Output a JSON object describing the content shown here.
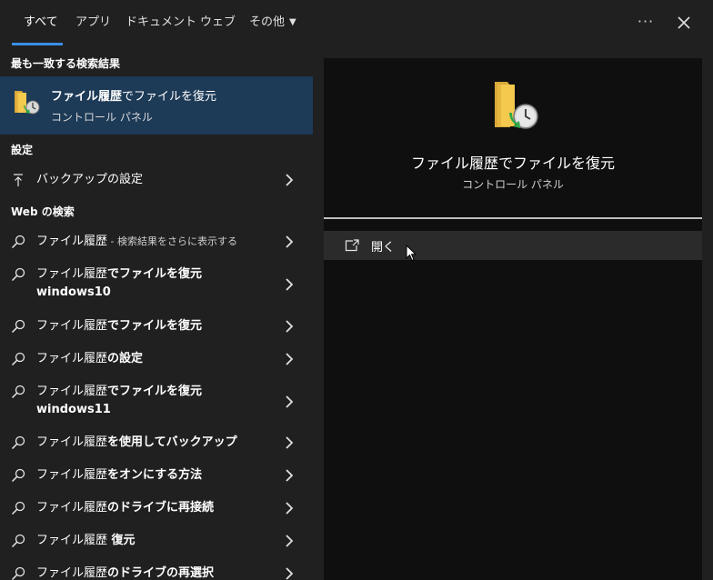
{
  "tabs": [
    {
      "label": "すべて",
      "active": true
    },
    {
      "label": "アプリ"
    },
    {
      "label": "ドキュメント"
    },
    {
      "label": "ウェブ"
    },
    {
      "label": "その他"
    }
  ],
  "controls": {
    "more": "···"
  },
  "sections": {
    "best_match": "最も一致する検索結果",
    "settings": "設定",
    "web": "Web の検索"
  },
  "best_match": {
    "title_bold": "ファイル履歴",
    "title_rest": "でファイルを復元",
    "subtitle": "コントロール パネル",
    "icon": "file-history-folder-icon"
  },
  "settings_items": [
    {
      "label": "バックアップの設定",
      "icon": "arrow-up-bar-icon"
    }
  ],
  "web_items": [
    {
      "normal": "ファイル履歴",
      "bold": "",
      "hint": " - 検索結果をさらに表示する",
      "line2": ""
    },
    {
      "normal": "ファイル履歴",
      "bold": "でファイルを復元",
      "hint": "",
      "line2": "windows10"
    },
    {
      "normal": "ファイル履歴",
      "bold": "でファイルを復元",
      "hint": "",
      "line2": ""
    },
    {
      "normal": "ファイル履歴",
      "bold": "の設定",
      "hint": "",
      "line2": ""
    },
    {
      "normal": "ファイル履歴",
      "bold": "でファイルを復元",
      "hint": "",
      "line2": "windows11"
    },
    {
      "normal": "ファイル履歴",
      "bold": "を使用してバックアップ",
      "hint": "",
      "line2": ""
    },
    {
      "normal": "ファイル履歴",
      "bold": "をオンにする方法",
      "hint": "",
      "line2": ""
    },
    {
      "normal": "ファイル履歴",
      "bold": "のドライブに再接続",
      "hint": "",
      "line2": ""
    },
    {
      "normal": "ファイル履歴",
      "bold": " 復元",
      "hint": "",
      "line2": ""
    },
    {
      "normal": "ファイル履歴",
      "bold": "のドライブの再選択",
      "hint": "",
      "line2": ""
    }
  ],
  "preview": {
    "title": "ファイル履歴でファイルを復元",
    "subtitle": "コントロール パネル",
    "actions": [
      {
        "label": "開く",
        "icon": "open-window-icon"
      }
    ]
  },
  "colors": {
    "accent": "#3b8ee6",
    "selected_bg": "#1d3a57",
    "panel_bg": "#202020",
    "preview_bg": "#0f0f0f"
  }
}
